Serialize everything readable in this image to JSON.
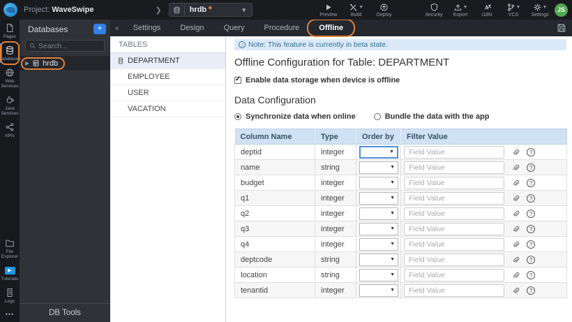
{
  "colors": {
    "accent_blue": "#2f80e7",
    "annotation_orange": "#e0823c",
    "note_bg": "#dbe9f8",
    "grid_header_bg": "#cfe1f3",
    "avatar_green": "#53a653",
    "active_rail_indicator": "#2e7ce0"
  },
  "topbar": {
    "project_prefix": "Project:",
    "project_name": "WaveSwipe",
    "db_selector_value": "hrdb",
    "actions": [
      {
        "label": "Preview",
        "icon": "preview-play-icon",
        "chevron": false
      },
      {
        "label": "Build",
        "icon": "build-tools-icon",
        "chevron": true
      },
      {
        "label": "Deploy",
        "icon": "deploy-upload-icon",
        "chevron": false
      }
    ],
    "right_actions": [
      {
        "label": "Security",
        "icon": "security-shield-icon",
        "chevron": false
      },
      {
        "label": "Export",
        "icon": "export-icon",
        "chevron": true
      },
      {
        "label": "i18N",
        "icon": "translate-icon",
        "chevron": false
      },
      {
        "label": "VCS",
        "icon": "vcs-branch-icon",
        "chevron": true
      },
      {
        "label": "Settings",
        "icon": "settings-gear-icon",
        "chevron": true
      }
    ],
    "avatar_initials": "JS"
  },
  "left_rail": {
    "top_items": [
      {
        "label": "Pages",
        "icon": "page-icon",
        "active": false,
        "annotated": false
      },
      {
        "label": "Databases",
        "icon": "database-icon",
        "active": true,
        "annotated": true
      },
      {
        "label": "Web Services",
        "icon": "globe-icon",
        "active": false,
        "annotated": false
      },
      {
        "label": "Java Services",
        "icon": "coffee-icon",
        "active": false,
        "annotated": false
      },
      {
        "label": "APIs",
        "icon": "api-icon",
        "active": false,
        "annotated": false
      }
    ],
    "bottom_items": [
      {
        "label": "File Explorer",
        "icon": "folder-icon",
        "active": false,
        "annotated": false
      },
      {
        "label": "Tutorials",
        "icon": "video-play-icon",
        "active": false,
        "annotated": false
      },
      {
        "label": "Logs",
        "icon": "logs-icon",
        "active": false,
        "annotated": false
      }
    ],
    "more_label": "•••"
  },
  "db_panel": {
    "title": "Databases",
    "add_button": "+",
    "search_placeholder": "Search...",
    "database_item": "hrdb",
    "footer_button": "DB Tools"
  },
  "tab_bar": {
    "tabs": [
      {
        "label": "Settings",
        "active": false,
        "annotated": false
      },
      {
        "label": "Design",
        "active": false,
        "annotated": false
      },
      {
        "label": "Query",
        "active": false,
        "annotated": false
      },
      {
        "label": "Procedure",
        "active": false,
        "annotated": false
      },
      {
        "label": "Offline",
        "active": true,
        "annotated": true
      }
    ]
  },
  "tables_panel": {
    "header": "TABLES",
    "items": [
      {
        "label": "DEPARTMENT",
        "selected": true
      },
      {
        "label": "EMPLOYEE",
        "selected": false
      },
      {
        "label": "USER",
        "selected": false
      },
      {
        "label": "VACATION",
        "selected": false
      }
    ]
  },
  "content": {
    "note": "Note: This feature is currently in beta state.",
    "page_title": "Offline Configuration for Table: DEPARTMENT",
    "enable_offline_label": "Enable data storage when device is offline",
    "enable_offline_checked": true,
    "section_title": "Data Configuration",
    "sync_options": [
      {
        "label": "Synchronize data when online",
        "selected": true
      },
      {
        "label": "Bundle the data with the app",
        "selected": false
      }
    ],
    "columns_grid": {
      "headers": [
        "Column Name",
        "Type",
        "Order by",
        "Filter Value"
      ],
      "filter_placeholder": "Field Value",
      "order_by_value": "",
      "rows": [
        {
          "column_name": "deptid",
          "type": "integer"
        },
        {
          "column_name": "name",
          "type": "string"
        },
        {
          "column_name": "budget",
          "type": "integer"
        },
        {
          "column_name": "q1",
          "type": "integer"
        },
        {
          "column_name": "q2",
          "type": "integer"
        },
        {
          "column_name": "q3",
          "type": "integer"
        },
        {
          "column_name": "q4",
          "type": "integer"
        },
        {
          "column_name": "deptcode",
          "type": "string"
        },
        {
          "column_name": "location",
          "type": "string"
        },
        {
          "column_name": "tenantid",
          "type": "integer"
        }
      ]
    }
  }
}
